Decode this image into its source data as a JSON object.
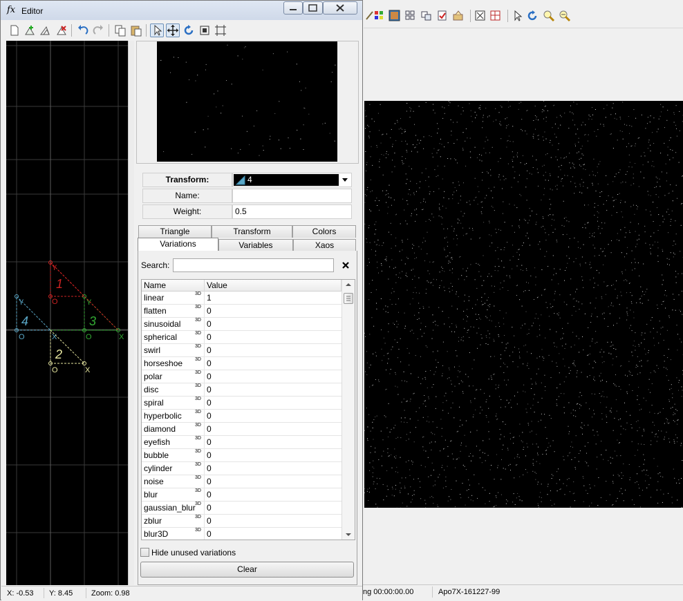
{
  "editor": {
    "title": "Editor",
    "title_icon": "fx",
    "transform_label": "Transform:",
    "transform_value": "4",
    "name_label": "Name:",
    "name_value": "",
    "weight_label": "Weight:",
    "weight_value": "0.5",
    "tabs_row1": [
      "Triangle",
      "Transform",
      "Colors"
    ],
    "tabs_row2": [
      "Variations",
      "Variables",
      "Xaos"
    ],
    "active_tab": "Variations",
    "search_label": "Search:",
    "search_value": "",
    "table_headers": [
      "Name",
      "Value"
    ],
    "variations": [
      {
        "name": "linear",
        "tag": "3D",
        "value": "1"
      },
      {
        "name": "flatten",
        "tag": "3D",
        "value": "0"
      },
      {
        "name": "sinusoidal",
        "tag": "3D",
        "value": "0"
      },
      {
        "name": "spherical",
        "tag": "3D",
        "value": "0"
      },
      {
        "name": "swirl",
        "tag": "3D",
        "value": "0"
      },
      {
        "name": "horseshoe",
        "tag": "3D",
        "value": "0"
      },
      {
        "name": "polar",
        "tag": "3D",
        "value": "0"
      },
      {
        "name": "disc",
        "tag": "3D",
        "value": "0"
      },
      {
        "name": "spiral",
        "tag": "3D",
        "value": "0"
      },
      {
        "name": "hyperbolic",
        "tag": "3D",
        "value": "0"
      },
      {
        "name": "diamond",
        "tag": "3D",
        "value": "0"
      },
      {
        "name": "eyefish",
        "tag": "3D",
        "value": "0"
      },
      {
        "name": "bubble",
        "tag": "3D",
        "value": "0"
      },
      {
        "name": "cylinder",
        "tag": "3D",
        "value": "0"
      },
      {
        "name": "noise",
        "tag": "3D",
        "value": "0"
      },
      {
        "name": "blur",
        "tag": "3D",
        "value": "0"
      },
      {
        "name": "gaussian_blur",
        "tag": "3D",
        "value": "0"
      },
      {
        "name": "zblur",
        "tag": "3D",
        "value": "0"
      },
      {
        "name": "blur3D",
        "tag": "3D",
        "value": "0"
      }
    ],
    "hide_unused_label": "Hide unused variations",
    "hide_unused_checked": false,
    "clear_label": "Clear",
    "status": {
      "x": "X: -0.53",
      "y": "Y: 8.45",
      "zoom": "Zoom: 0.98"
    },
    "triangles": [
      {
        "label": "1",
        "color": "#cc2222",
        "o": "O",
        "x": "X",
        "y": "Y"
      },
      {
        "label": "2",
        "color": "#e8e8a0",
        "o": "O",
        "x": "X",
        "y": ""
      },
      {
        "label": "3",
        "color": "#33aa33",
        "o": "O",
        "x": "X",
        "y": "Y"
      },
      {
        "label": "4",
        "color": "#5aa8c8",
        "o": "O",
        "x": "X",
        "y": "Y"
      }
    ]
  },
  "main_status": {
    "time": "ng 00:00:00.00",
    "name": "Apo7X-161227-99"
  },
  "colors": {
    "render_bg": "#000000",
    "window_bg": "#f0f0f0"
  }
}
